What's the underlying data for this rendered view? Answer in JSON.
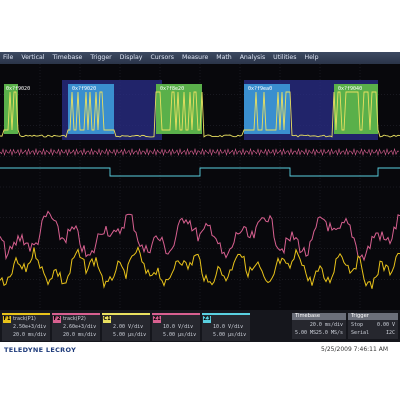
{
  "menu": [
    "File",
    "Vertical",
    "Timebase",
    "Trigger",
    "Display",
    "Cursors",
    "Measure",
    "Math",
    "Analysis",
    "Utilities",
    "Help"
  ],
  "decode_labels": [
    "0x?f9020",
    "0x?f9020",
    "0x?f8e20",
    "0x?f9ea0",
    "0x?f9040"
  ],
  "channels": [
    {
      "tag": "F1",
      "name": "track(P1)",
      "v1": "2.50e+3/div",
      "v2": "20.0 ms/div",
      "color": "#e9c31a"
    },
    {
      "tag": "F2",
      "name": "track(P2)",
      "v1": "2.60e+3/div",
      "v2": "20.0 ms/div",
      "color": "#d86090"
    },
    {
      "tag": "C1",
      "name": "",
      "v1": "2.00 V/div",
      "v2": "5.00 µs/div",
      "color": "#e9e060"
    },
    {
      "tag": "Z1",
      "name": "",
      "v1": "10.0 V/div",
      "v2": "5.00 µs/div",
      "color": "#e0e0e0"
    },
    {
      "tag": "Z3",
      "name": "",
      "v1": "10.0 V/div",
      "v2": "5.00 µs/div",
      "color": "#5ad0e0"
    }
  ],
  "timebase": {
    "header": "Timebase",
    "r1a": "20.0 ms/div",
    "r2a": "5.00 MS",
    "r2b": "25.0 MS/s"
  },
  "trigger": {
    "header": "Trigger",
    "r1a": "Stop",
    "r1b": "0.00 V",
    "r2a": "Serial",
    "r2b": "I2C"
  },
  "brand": "TELEDYNE LECROY",
  "date": "5/25/2009 7:46:11 AM",
  "colors": {
    "ch_yellow": "#e9c31a",
    "ch_pink": "#d86090",
    "ch_cyan": "#5ad0e0",
    "decode_blue": "#3a8fcf",
    "decode_green": "#5ab04a",
    "highlight": "#2a2e8a"
  }
}
